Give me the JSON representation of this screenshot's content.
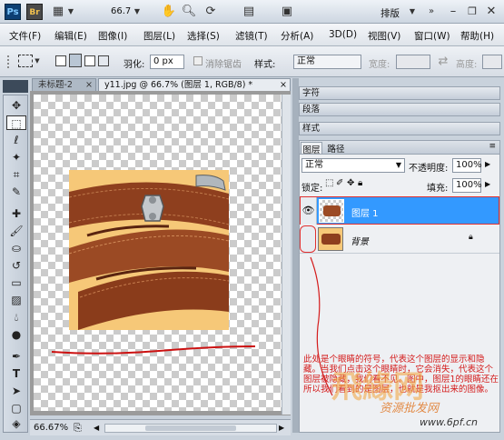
{
  "app": {
    "ps_logo": "Ps",
    "br_logo": "Br",
    "zoom": "66.7",
    "workspace": "排版"
  },
  "menu": [
    "文件(F)",
    "编辑(E)",
    "图像(I)",
    "图层(L)",
    "选择(S)",
    "滤镜(T)",
    "分析(A)",
    "3D(D)",
    "视图(V)",
    "窗口(W)",
    "帮助(H)"
  ],
  "options": {
    "feather_label": "羽化:",
    "feather_value": "0 px",
    "antialias_label": "消除锯齿",
    "style_label": "样式:",
    "style_value": "正常",
    "width_label": "宽度:",
    "height_label": "高度:"
  },
  "doc_tabs": [
    {
      "label": "未标题-2",
      "close": "×"
    },
    {
      "label": "y11.jpg @ 66.7% (图层 1, RGB/8) *",
      "close": "×"
    }
  ],
  "status": {
    "zoom": "66.67%"
  },
  "panels": {
    "character": "字符",
    "paragraph": "段落",
    "styles": "样式",
    "layers_tab": "图层",
    "paths_tab": "路径"
  },
  "layers": {
    "blend_mode": "正常",
    "opacity_label": "不透明度:",
    "opacity_value": "100%",
    "lock_label": "锁定:",
    "fill_label": "填充:",
    "fill_value": "100%",
    "items": [
      {
        "name": "图层 1",
        "selected": true,
        "visible": true
      },
      {
        "name": "背景",
        "selected": false,
        "visible": false,
        "locked": true
      }
    ]
  },
  "annotation": {
    "text": "此处是个眼睛的符号，代表这个图层的显示和隐藏。当我们点击这个眼睛时，它会消失，代表这个图层被隐藏，我们看不见。图中，图层1的眼睛还在所以我们看到的是图层，也就是我抠出来的图像。"
  },
  "watermark": {
    "logo": "飛緣网",
    "tagline": "资源批发网",
    "url": "www.6pf.cn"
  },
  "colors": {
    "accent": "#3399ff",
    "annotation": "#d41b1b",
    "brand_orange": "#f2a23a"
  }
}
